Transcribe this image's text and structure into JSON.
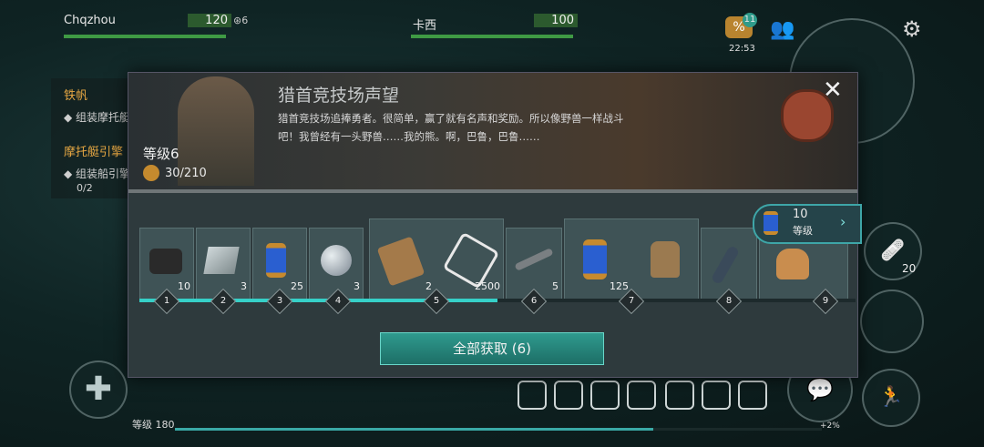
{
  "hud": {
    "player1": {
      "name": "Chqzhou",
      "hp": "120",
      "tokens": "6"
    },
    "player2": {
      "name": "卡西",
      "hp": "100"
    },
    "discount_badge": "11",
    "clock": "22:53",
    "side_count": "20",
    "bottom_level": "等级 180",
    "bottom_percent": "+2%"
  },
  "quests": [
    {
      "title": "铁帆",
      "step": "组装摩托艇"
    },
    {
      "title": "摩托艇引擎",
      "step": "组装船引擎",
      "progress": "0/2"
    }
  ],
  "modal": {
    "title": "猎首竞技场声望",
    "description": "猎首竞技场追捧勇者。很简单，赢了就有名声和奖励。所以像野兽一样战斗吧！我曾经有一头野兽……我的熊。啊，巴鲁，巴鲁……",
    "level_label": "等级6",
    "xp_text": "30/210",
    "claim_button": "全部获取 (6)",
    "level_badge": {
      "value": "10",
      "label": "等级"
    },
    "rewards": [
      {
        "tier": "1",
        "items": [
          {
            "icon": "scrap-icon",
            "count": "10"
          }
        ]
      },
      {
        "tier": "2",
        "items": [
          {
            "icon": "metal-sheet-icon",
            "count": "3"
          }
        ]
      },
      {
        "tier": "3",
        "items": [
          {
            "icon": "blue-canister-icon",
            "count": "25"
          }
        ]
      },
      {
        "tier": "4",
        "items": [
          {
            "icon": "glass-lens-icon",
            "count": "3"
          }
        ]
      },
      {
        "tier": "5",
        "items": [
          {
            "icon": "quiver-icon",
            "count": "2"
          },
          {
            "icon": "arena-emblem-icon",
            "count": "2500"
          }
        ]
      },
      {
        "tier": "6",
        "items": [
          {
            "icon": "pipe-icon",
            "count": "5"
          }
        ]
      },
      {
        "tier": "7",
        "items": [
          {
            "icon": "blue-canister-icon",
            "count": "125"
          },
          {
            "icon": "backpack-icon",
            "count": ""
          }
        ]
      },
      {
        "tier": "8",
        "items": [
          {
            "icon": "bolas-icon",
            "count": ""
          }
        ]
      },
      {
        "tier": "9",
        "items": [
          {
            "icon": "dog-icon",
            "count": ""
          }
        ]
      }
    ],
    "progress_fraction": 0.5
  },
  "colors": {
    "accent": "#36d0c8",
    "hp": "#3f9a44",
    "quest": "#e6a743"
  }
}
